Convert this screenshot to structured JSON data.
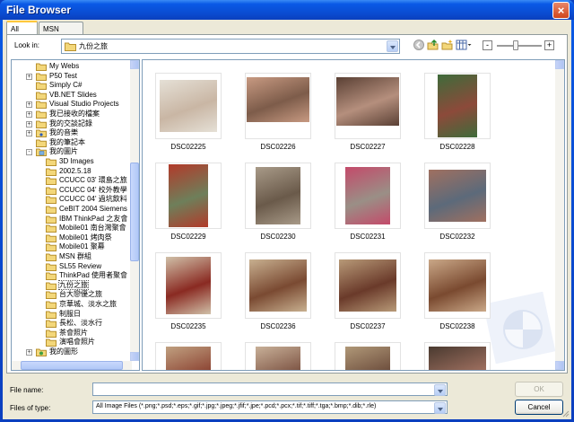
{
  "window": {
    "title": "File Browser",
    "close_glyph": "×"
  },
  "tabs": [
    {
      "label": "All Files",
      "active": true
    },
    {
      "label": "MSN Groups",
      "active": false
    }
  ],
  "lookin": {
    "label": "Look in:",
    "value": "九份之旅"
  },
  "toolbar": {
    "icons": [
      "back-icon",
      "up-folder-icon",
      "new-folder-icon",
      "view-menu-icon"
    ],
    "zoom_minus": "-",
    "zoom_plus": "+",
    "zoom_level": 0.4
  },
  "tree": {
    "items": [
      {
        "label": "My Webs",
        "expander": ""
      },
      {
        "label": "P50 Test",
        "expander": "+"
      },
      {
        "label": "Simply C#",
        "expander": ""
      },
      {
        "label": "VB.NET Slides",
        "expander": ""
      },
      {
        "label": "Visual Studio Projects",
        "expander": "+"
      },
      {
        "label": "我已接收的檔案",
        "expander": "+"
      },
      {
        "label": "我的交談記錄",
        "expander": "+"
      },
      {
        "label": "我的音樂",
        "expander": "+",
        "special": "music"
      },
      {
        "label": "我的筆記本",
        "expander": ""
      },
      {
        "label": "我的圖片",
        "expander": "-",
        "special": "pictures"
      },
      {
        "label": "3D Images",
        "expander": "",
        "child": true
      },
      {
        "label": "2002.5.18",
        "expander": "",
        "child": true
      },
      {
        "label": "CCUCC 03' 環島之旅",
        "expander": "",
        "child": true
      },
      {
        "label": "CCUCC 04' 校外教學",
        "expander": "",
        "child": true
      },
      {
        "label": "CCUCC 04' 過坑飲料",
        "expander": "",
        "child": true
      },
      {
        "label": "CeBIT 2004 Siemens",
        "expander": "",
        "child": true
      },
      {
        "label": "IBM ThinkPad 之友會",
        "expander": "",
        "child": true
      },
      {
        "label": "Mobile01 南台灣聚會",
        "expander": "",
        "child": true
      },
      {
        "label": "Mobile01 烤肉祭",
        "expander": "",
        "child": true
      },
      {
        "label": "Mobile01 聚幕",
        "expander": "",
        "child": true
      },
      {
        "label": "MSN 群組",
        "expander": "",
        "child": true
      },
      {
        "label": "SL55 Review",
        "expander": "",
        "child": true
      },
      {
        "label": "ThinkPad 使用者聚會",
        "expander": "",
        "child": true
      },
      {
        "label": "九份之旅",
        "expander": "",
        "child": true,
        "selected": true
      },
      {
        "label": "台大戀優之旅",
        "expander": "",
        "child": true
      },
      {
        "label": "京華城、淡水之旅",
        "expander": "",
        "child": true
      },
      {
        "label": "制服日",
        "expander": "",
        "child": true
      },
      {
        "label": "長松、淡水行",
        "expander": "",
        "child": true
      },
      {
        "label": "茶會照片",
        "expander": "",
        "child": true
      },
      {
        "label": "演唱會照片",
        "expander": "",
        "child": true
      },
      {
        "label": "我的圖形",
        "expander": "+",
        "special": "shapes"
      }
    ]
  },
  "files": [
    {
      "name": "DSC02225",
      "color": "#c9b6a4",
      "accent": "#e5e0d6"
    },
    {
      "name": "DSC02226",
      "color": "#7d5c4a",
      "accent": "#c89a82"
    },
    {
      "name": "DSC02227",
      "color": "#b58f7d",
      "accent": "#5a4034"
    },
    {
      "name": "DSC02228",
      "color": "#8c4a3a",
      "accent": "#3e6b3a"
    },
    {
      "name": "DSC02229",
      "color": "#6e7f5a",
      "accent": "#b23a2a"
    },
    {
      "name": "DSC02230",
      "color": "#6a5a4a",
      "accent": "#a89a88"
    },
    {
      "name": "DSC02231",
      "color": "#9a8f86",
      "accent": "#c44a6a"
    },
    {
      "name": "DSC02232",
      "color": "#5c6a7a",
      "accent": "#a07060"
    },
    {
      "name": "DSC02235",
      "color": "#8a2a22",
      "accent": "#d0c0a8"
    },
    {
      "name": "DSC02236",
      "color": "#7a4a32",
      "accent": "#c8b090"
    },
    {
      "name": "DSC02237",
      "color": "#6a3a2a",
      "accent": "#b89a78"
    },
    {
      "name": "DSC02238",
      "color": "#7a4a30",
      "accent": "#caa888"
    },
    {
      "name": "",
      "color": "#8a4030",
      "accent": "#c0a080"
    },
    {
      "name": "",
      "color": "#7a5040",
      "accent": "#c8b098"
    },
    {
      "name": "",
      "color": "#6a4a3a",
      "accent": "#b09878"
    },
    {
      "name": "",
      "color": "#a07060",
      "accent": "#4a3a30"
    }
  ],
  "bottom": {
    "file_name_label": "File name:",
    "file_name_value": "",
    "files_of_type_label": "Files of type:",
    "files_of_type_value": "All Image Files (*.png;*.psd;*.eps;*.gif;*.jpg;*.jpeg;*.jfif;*.jpe;*.pcd;*.pcx;*.tif;*.tiff;*.tga;*.bmp;*.dib;*.rle)",
    "ok_label": "OK",
    "cancel_label": "Cancel"
  }
}
